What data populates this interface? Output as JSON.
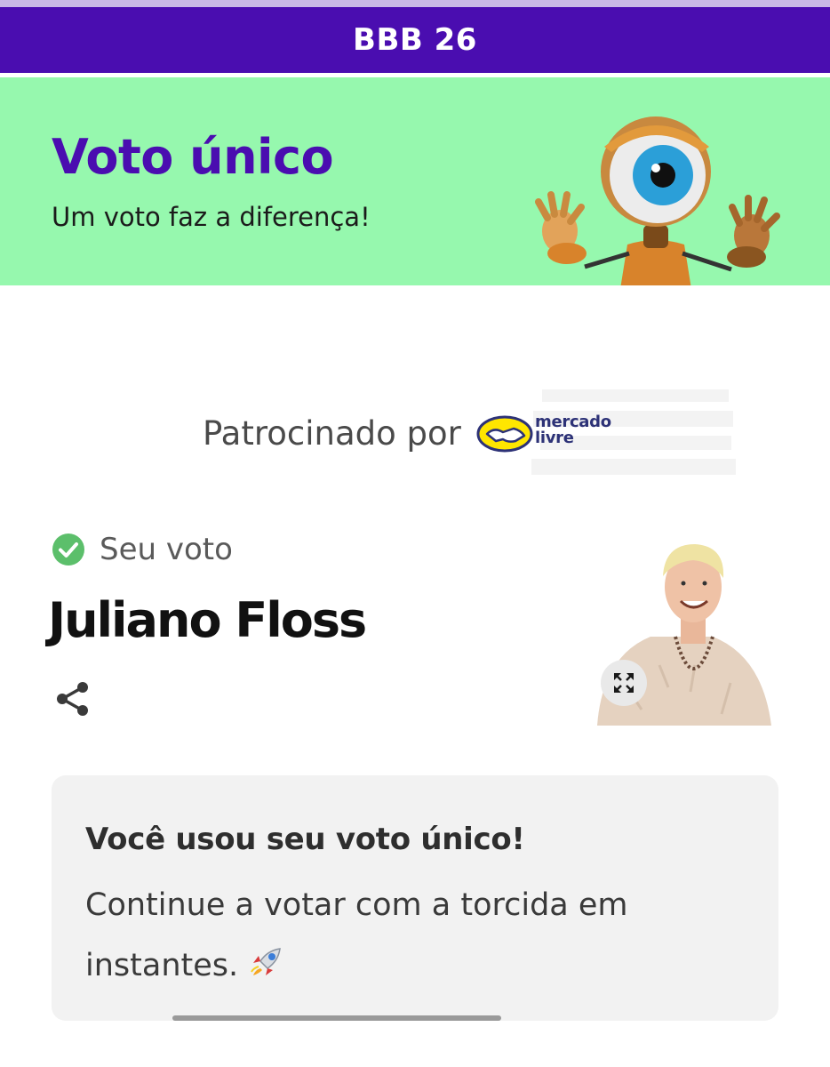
{
  "header": {
    "title": "BBB 26"
  },
  "banner": {
    "title": "Voto único",
    "subtitle": "Um voto faz a diferença!",
    "mascot_icon": "big-brother-eye-robot-mascot"
  },
  "sponsor": {
    "label": "Patrocinado por",
    "logo_text_line1": "mercado",
    "logo_text_line2": "livre",
    "logo_icon": "handshake-logo"
  },
  "vote": {
    "status_label": "Seu voto",
    "status_icon": "check-circle-icon",
    "candidate_name": "Juliano Floss",
    "share_icon": "share-icon",
    "expand_icon": "expand-icon"
  },
  "info": {
    "title": "Você usou seu voto único!",
    "body": "Continue a votar com a torcida em instantes.",
    "emoji_icon": "rocket-icon"
  },
  "colors": {
    "header_bg": "#4a0db0",
    "banner_bg": "#96f8ae",
    "accent_purple": "#4a0db0",
    "check_green": "#5cbf6b",
    "card_bg": "#f2f2f2"
  }
}
